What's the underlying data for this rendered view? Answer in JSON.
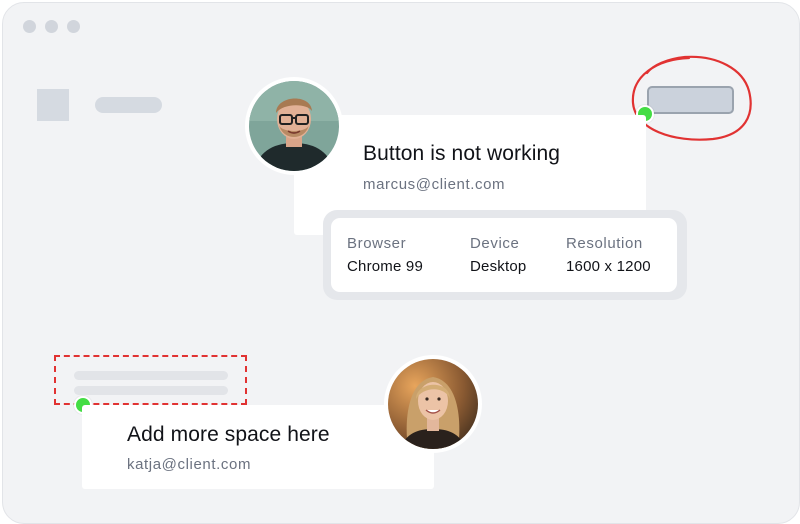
{
  "window": {
    "controls": [
      "window-dot",
      "window-dot",
      "window-dot"
    ]
  },
  "feedback_1": {
    "title": "Button is not working",
    "email": "marcus@client.com",
    "annotation_color": "#e13232",
    "pin_color": "#44dd44",
    "avatar_icon": "man-with-glasses-avatar"
  },
  "details": {
    "browser_label": "Browser",
    "browser_value": "Chrome 99",
    "device_label": "Device",
    "device_value": "Desktop",
    "resolution_label": "Resolution",
    "resolution_value": "1600 x 1200"
  },
  "feedback_2": {
    "title": "Add more space here",
    "email": "katja@client.com",
    "annotation_color": "#e13232",
    "pin_color": "#44dd44",
    "avatar_icon": "woman-avatar"
  }
}
